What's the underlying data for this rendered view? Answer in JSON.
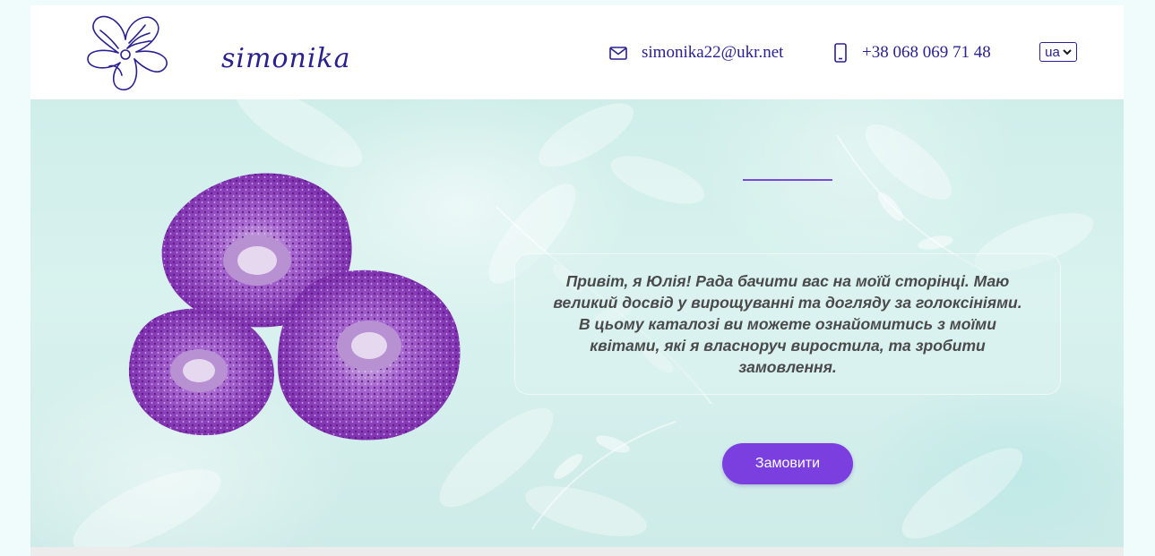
{
  "header": {
    "brand": "simonika",
    "email": "simonika22@ukr.net",
    "phone": "+38 068 069 71 48",
    "language": "ua"
  },
  "hero": {
    "intro": "Привіт, я Юлія! Рада бачити вас на моїй сторінці. Маю\nвеликий досвід у вирощуванні та догляду за голоксініями.\nВ цьому каталозі ви можете ознайомитись з моїми\nквітами, які я власноруч виростила, та зробити\nзамовлення.",
    "order_label": "Замовити"
  },
  "colors": {
    "brand": "#2a2190",
    "accent": "#7b3fe0",
    "flower": "#8e3cc0"
  },
  "icons": {
    "logo": "flower-logo-icon",
    "email": "envelope-icon",
    "phone": "mobile-phone-icon",
    "dropdown": "chevron-down-icon"
  }
}
